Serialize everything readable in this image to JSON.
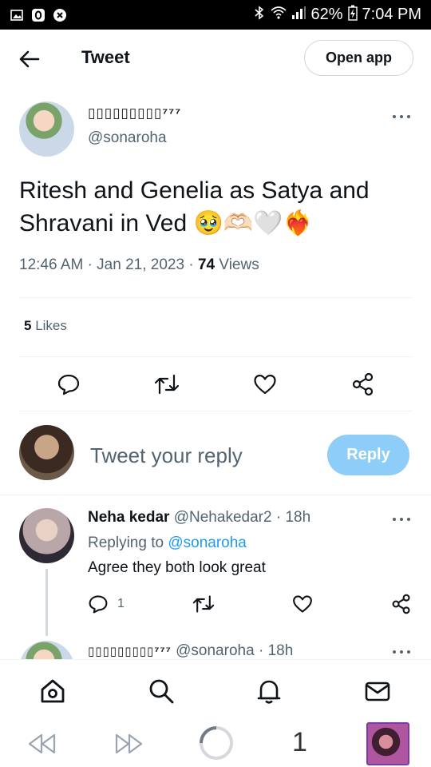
{
  "status_bar": {
    "battery": "62%",
    "time": "7:04 PM"
  },
  "header": {
    "title": "Tweet",
    "open_app": "Open app"
  },
  "tweet": {
    "author_name": "▯▯▯▯▯▯▯▯▯⁷⁷⁷",
    "author_handle": "@sonaroha",
    "text": "Ritesh and Genelia as Satya and Shravani in Ved 🥹🫶🏻🤍❤️‍🔥",
    "time": "12:46 AM",
    "date": "Jan 21, 2023",
    "views_count": "74",
    "views_label": "Views",
    "likes_count": "5",
    "likes_label": "Likes"
  },
  "composer": {
    "placeholder": "Tweet your reply",
    "reply_button": "Reply"
  },
  "replies": [
    {
      "name": "Neha kedar",
      "handle": "@Nehakedar2",
      "age": "18h",
      "replying_label": "Replying to",
      "replying_to": "@sonaroha",
      "text": "Agree they both look great",
      "reply_count": "1"
    },
    {
      "name": "▯▯▯▯▯▯▯▯▯⁷⁷⁷",
      "handle": "@sonaroha",
      "age": "18h"
    }
  ],
  "browser": {
    "tab_count": "1"
  },
  "colors": {
    "accent": "#1d9bf0",
    "reply_button": "#8ecdf7",
    "secondary_text": "#536471"
  }
}
